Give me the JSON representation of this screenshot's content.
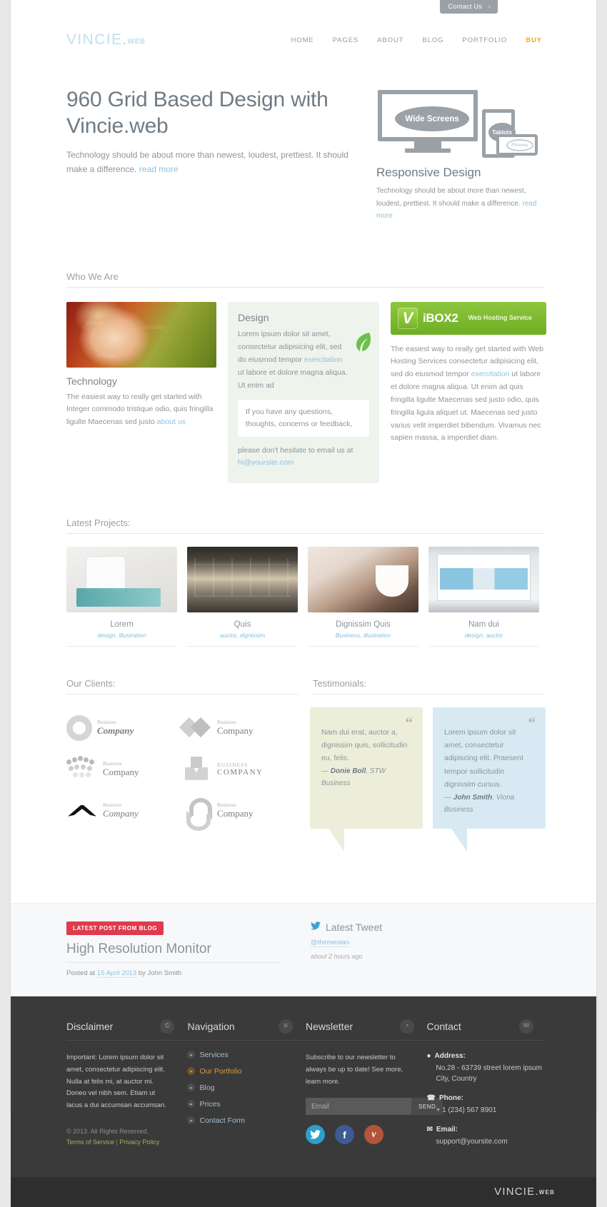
{
  "topbar": {
    "contact_label": "Contact Us",
    "chevron": "›"
  },
  "header": {
    "logo_main": "VINCIE",
    "logo_dot": ".",
    "logo_sub": "WEB",
    "nav": [
      {
        "label": "HOME",
        "accent": false
      },
      {
        "label": "PAGES",
        "accent": false
      },
      {
        "label": "ABOUT",
        "accent": false
      },
      {
        "label": "BLOG",
        "accent": false
      },
      {
        "label": "PORTFOLIO",
        "accent": false
      },
      {
        "label": "BUY",
        "accent": true
      }
    ]
  },
  "hero": {
    "title": "960 Grid Based Design with Vincie.web",
    "subtitle": "Technology should be about more than newest, loudest, prettiest. It should make a difference.",
    "read_more": "read more",
    "devices": {
      "wide": "Wide Screens",
      "tablet": "Tablots",
      "phone": "Phones"
    },
    "responsive_title": "Responsive Design",
    "responsive_text": "Technology should be about more than newest, loudest, prettiest. It should make a difference.",
    "responsive_read_more": "read more"
  },
  "who_we_are": {
    "heading": "Who We Are",
    "technology": {
      "title": "Technology",
      "body": "The easiest way to really get started with Integer commodo tristique odio, quis fringilla ligulte Maecenas sed justo ",
      "link": "about us",
      "watermark": "envato"
    },
    "design": {
      "title": "Design",
      "body_pre": "Lorem ipsum dolor sit amet, consectetur adipisicing elit, sed do eiusmod tempor ",
      "body_link": "exercitation",
      "body_post": " ut labore et dolore magna aliqua. Ut enim ad",
      "quote": "If you have any questions, thoughts, concerns or feedback,",
      "foot_pre": "please don't hesitate to email us at ",
      "email": "hi@yoursite.com"
    },
    "hosting": {
      "brand_v": "V",
      "brand_name": "iBOX2",
      "brand_service": "Web Hosting Service",
      "body_pre": "The easiest way to really get started with Web Hosting Services consectetur adipisicing elit, sed do eiusmod tempor ",
      "body_link": "exercitation",
      "body_post": " ut labore et dolore magna aliqua. Ut enim ad quis fringilla ligulte Maecenas sed justo odio, quis fringilla ligula aliquet ut. Maecenas sed justo varius velit imperdiet bibendum. Vivamus nec sapien massa, a imperdiet diam."
    }
  },
  "projects": {
    "heading": "Latest Projects:",
    "items": [
      {
        "name": "Lorem",
        "tags": "design, illustration"
      },
      {
        "name": "Quis",
        "tags": "auctor, dignissim"
      },
      {
        "name": "Dignissim Quis",
        "tags": "Business, illustration"
      },
      {
        "name": "Nam dui",
        "tags": "design, auctor"
      }
    ]
  },
  "clients": {
    "heading": "Our Clients:",
    "logos": [
      {
        "small": "Business",
        "big": "Company"
      },
      {
        "small": "Business",
        "big": "Company"
      },
      {
        "small": "Business",
        "big": "Company"
      },
      {
        "small": "BUSINESS",
        "big": "COMPANY"
      },
      {
        "small": "Business",
        "big": "Company"
      },
      {
        "small": "Business",
        "big": "Company"
      }
    ]
  },
  "testimonials": {
    "heading": "Testimonials:",
    "quote_mark": "“",
    "items": [
      {
        "text": "Nam dui erat, auctor a, dignissim quis, sollicitudin eu, felis.",
        "author": "Donie Boll",
        "company": ", STW Business"
      },
      {
        "text": "Lorem ipsum dolor sit amet, consectetur adipiscing elit. Praesent tempor sollicitudin dignissim cursus.",
        "author": "John Smith",
        "company": ", Viona Business"
      }
    ]
  },
  "blog_strip": {
    "badge": "LATEST POST FROM BLOG",
    "post_title": "High Resolution Monitor",
    "meta_pre": "Posted at ",
    "meta_date": "15 April 2013",
    "meta_post": " by John Smith",
    "tweet_title": "Latest Tweet",
    "tweet_handle": "@themestan",
    "tweet_time": "about 2 hours ago"
  },
  "footer": {
    "disclaimer": {
      "title": "Disclaimer",
      "icon": "©",
      "body": "Important: Lorem ipsum dolor sit amet, consectetur adipiscing elit. Nulla at felis mi, at auctor mi. Doneo vel nibh sem. Etiam ut lacus a dui accumsan accumsan.",
      "copyright": "© 2013. All Rights Reserved.",
      "tos": "Terms of Service",
      "sep": " | ",
      "privacy": "Privacy Policy"
    },
    "navigation": {
      "title": "Navigation",
      "icon": "≡",
      "items": [
        {
          "label": "Services",
          "accent": false
        },
        {
          "label": "Our Portfolio",
          "accent": true
        },
        {
          "label": "Blog",
          "accent": false
        },
        {
          "label": "Prices",
          "accent": false
        },
        {
          "label": "Contact Form",
          "accent": false
        }
      ]
    },
    "newsletter": {
      "title": "Newsletter",
      "icon": "◔",
      "body": "Subscribe to our newsletter to always be up to date! See more, learn more.",
      "placeholder": "Email",
      "send_label": "SEND",
      "socials": [
        {
          "name": "twitter",
          "glyph": "ᵥ"
        },
        {
          "name": "facebook",
          "glyph": "f"
        },
        {
          "name": "vimeo",
          "glyph": "v"
        }
      ]
    },
    "contact": {
      "title": "Contact",
      "icon": "✉",
      "address_label": "Address:",
      "address_value": "No.28 - 63739 street lorem ipsum City, Country",
      "phone_label": "Phone:",
      "phone_value": "+ 1 (234) 567 8901",
      "email_label": "Email:",
      "email_value": "support@yoursite.com"
    },
    "bottom_logo_main": "VINCIE",
    "bottom_logo_dot": ".",
    "bottom_logo_sub": "WEB"
  }
}
